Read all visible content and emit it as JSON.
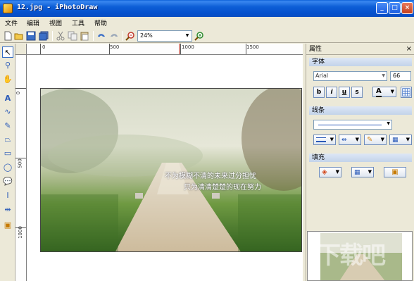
{
  "window": {
    "title": "12.jpg - iPhotoDraw",
    "min": "_",
    "max": "□",
    "close": "×"
  },
  "menu": [
    "文件",
    "编辑",
    "视图",
    "工具",
    "帮助"
  ],
  "toolbar": {
    "zoom_value": "24%"
  },
  "rulers": {
    "top_labels": [
      "0",
      "500",
      "1000",
      "1500"
    ],
    "left_labels": [
      "0",
      "500",
      "1000"
    ]
  },
  "photo": {
    "line1": "不为模糊不清的未来过分担忧",
    "line2": "只为清清楚楚的现在努力"
  },
  "panel": {
    "title": "属性",
    "close": "×",
    "font_section": "字体",
    "font_name": "Arial",
    "font_size": "66",
    "bold": "b",
    "italic": "i",
    "underline": "u",
    "strike": "s",
    "font_color": "A",
    "line_section": "线条",
    "fill_section": "填充"
  },
  "colors": {
    "titlebar": "#0550cc",
    "accent": "#316ac5"
  },
  "icons": {
    "toolbar": [
      "new-icon",
      "open-icon",
      "save-icon",
      "save-all-icon",
      "cut-icon",
      "copy-icon",
      "paste-icon",
      "undo-icon",
      "redo-icon",
      "zoom-out-icon",
      "zoom-in-icon"
    ],
    "palette": [
      "pointer-icon",
      "zoom-icon",
      "hand-icon",
      "text-icon",
      "curve-icon",
      "pen-icon",
      "polygon-icon",
      "rectangle-icon",
      "ellipse-icon",
      "callout-icon",
      "text-cursor-icon",
      "resize-icon",
      "image-icon"
    ]
  }
}
